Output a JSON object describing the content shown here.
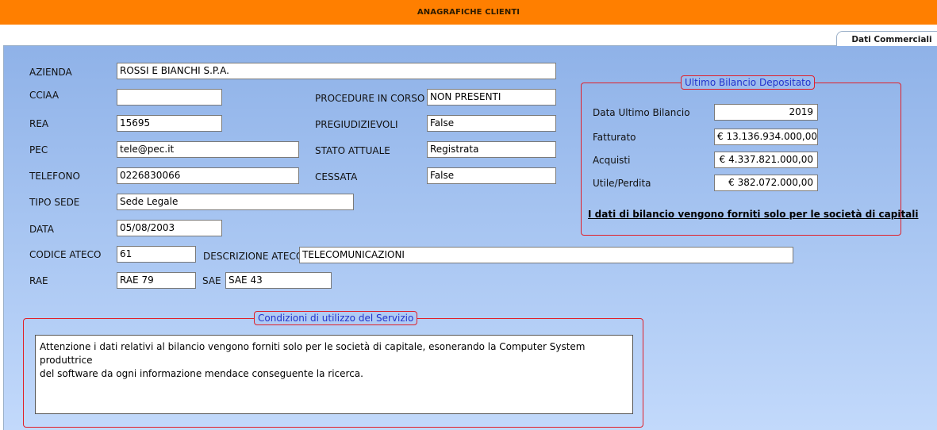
{
  "window": {
    "title": "ANAGRAFICHE CLIENTI"
  },
  "tabs": [
    {
      "label": "Dati Commerciali",
      "active": true
    }
  ],
  "form": {
    "azienda": {
      "label": "AZIENDA",
      "value": "ROSSI E BIANCHI S.P.A."
    },
    "cciaa": {
      "label": "CCIAA",
      "value": ""
    },
    "rea": {
      "label": "REA",
      "value": "15695"
    },
    "pec": {
      "label": "PEC",
      "value": "tele@pec.it"
    },
    "telefono": {
      "label": "TELEFONO",
      "value": "0226830066"
    },
    "tipo_sede": {
      "label": "TIPO SEDE",
      "value": "Sede Legale"
    },
    "data": {
      "label": "DATA",
      "value": "05/08/2003"
    },
    "codice_ateco": {
      "label": "CODICE ATECO",
      "value": "61"
    },
    "descrizione_ateco": {
      "label": "DESCRIZIONE ATECO",
      "value": "TELECOMUNICAZIONI"
    },
    "rae": {
      "label": "RAE",
      "value": "RAE 79"
    },
    "sae": {
      "label": "SAE",
      "value": "SAE 43"
    },
    "procedure_in_corso": {
      "label": "PROCEDURE IN CORSO",
      "value": "NON PRESENTI"
    },
    "pregiudizievoli": {
      "label": "PREGIUDIZIEVOLI",
      "value": "False"
    },
    "stato_attuale": {
      "label": "STATO ATTUALE",
      "value": "Registrata"
    },
    "cessata": {
      "label": "CESSATA",
      "value": "False"
    }
  },
  "bilancio": {
    "title": "Ultimo Bilancio Depositato",
    "data_ultimo": {
      "label": "Data Ultimo Bilancio",
      "value": "2019"
    },
    "fatturato": {
      "label": "Fatturato",
      "value": "€ 13.136.934.000,00"
    },
    "acquisti": {
      "label": "Acquisti",
      "value": "€ 4.337.821.000,00"
    },
    "utile": {
      "label": "Utile/Perdita",
      "value": "€ 382.072.000,00"
    },
    "note": "I dati di bilancio vengono forniti solo per le società di capitali"
  },
  "condizioni": {
    "title": "Condizioni di utilizzo del Servizio",
    "text": "Attenzione i dati relativi al bilancio vengono forniti solo per le società di capitale, esonerando la Computer System produttrice\ndel software da ogni informazione mendace conseguente la ricerca."
  },
  "colors": {
    "titlebar": "#ff7f00",
    "group_border": "#e0202a",
    "legend_text": "#2233cc"
  }
}
